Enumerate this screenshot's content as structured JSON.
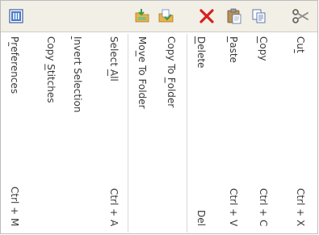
{
  "menu": {
    "items": [
      {
        "id": "cut",
        "pre": "Cu",
        "accel": "t",
        "post": "",
        "shortcut": "Ctrl + X",
        "icon": "scissors-icon"
      },
      {
        "id": "copy",
        "pre": "",
        "accel": "C",
        "post": "opy",
        "shortcut": "Ctrl + C",
        "icon": "copy-icon"
      },
      {
        "id": "paste",
        "pre": "",
        "accel": "P",
        "post": "aste",
        "shortcut": "Ctrl + V",
        "icon": "paste-icon"
      },
      {
        "id": "delete",
        "pre": "",
        "accel": "D",
        "post": "elete",
        "shortcut": "Del",
        "icon": "delete-x-icon"
      },
      {
        "id": "copy-to-folder",
        "pre": "Copy To ",
        "accel": "F",
        "post": "older",
        "shortcut": "",
        "icon": "copy-to-folder-icon"
      },
      {
        "id": "move-to-folder",
        "pre": "Mo",
        "accel": "v",
        "post": "e To Folder",
        "shortcut": "",
        "icon": "move-to-folder-icon"
      },
      {
        "id": "select-all",
        "pre": "Select ",
        "accel": "A",
        "post": "ll",
        "shortcut": "Ctrl + A",
        "icon": ""
      },
      {
        "id": "invert-selection",
        "pre": "",
        "accel": "I",
        "post": "nvert Selection",
        "shortcut": "",
        "icon": ""
      },
      {
        "id": "copy-stitches",
        "pre": "Copy ",
        "accel": "S",
        "post": "titches",
        "shortcut": "",
        "icon": ""
      },
      {
        "id": "preferences",
        "pre": "P",
        "accel": "r",
        "post": "eferences",
        "shortcut": "Ctrl + M",
        "icon": "preferences-icon"
      }
    ]
  }
}
